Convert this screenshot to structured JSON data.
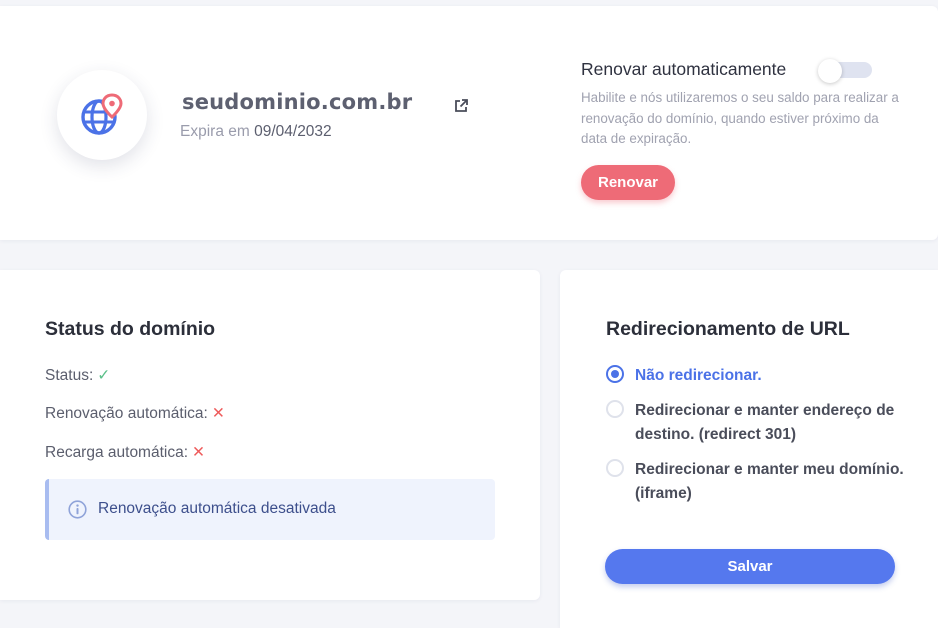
{
  "domain": {
    "name": "seudominio.com.br",
    "expires_label": "Expira em",
    "expires_date": "09/04/2032",
    "logo_icon": "globe-location-icon",
    "external_link_icon": "external-link-icon"
  },
  "auto_renew": {
    "title": "Renovar automaticamente",
    "enabled": false,
    "description": "Habilite e nós utilizaremos o seu saldo para realizar a renovação do domínio, quando estiver próximo da data de expiração.",
    "renew_button": "Renovar"
  },
  "status_section": {
    "title": "Status do domínio",
    "rows": [
      {
        "label": "Status:",
        "mark": "✓",
        "ok": true
      },
      {
        "label": "Renovação automática:",
        "mark": "✕",
        "ok": false
      },
      {
        "label": "Recarga automática:",
        "mark": "✕",
        "ok": false
      }
    ],
    "info_icon": "info-icon",
    "info_message": "Renovação automática desativada"
  },
  "redirect_section": {
    "title": "Redirecionamento de URL",
    "options": [
      {
        "label": "Não redirecionar.",
        "selected": true
      },
      {
        "label": "Redirecionar e manter endereço de destino. (redirect 301)",
        "selected": false
      },
      {
        "label": "Redirecionar e manter meu domínio. (iframe)",
        "selected": false
      }
    ],
    "save_button": "Salvar"
  },
  "colors": {
    "accent_blue": "#4b72e7",
    "renew_red": "#ee6b77",
    "success_green": "#5cc08a",
    "error_red": "#ee5a5a",
    "info_bg": "#eff3fd"
  }
}
